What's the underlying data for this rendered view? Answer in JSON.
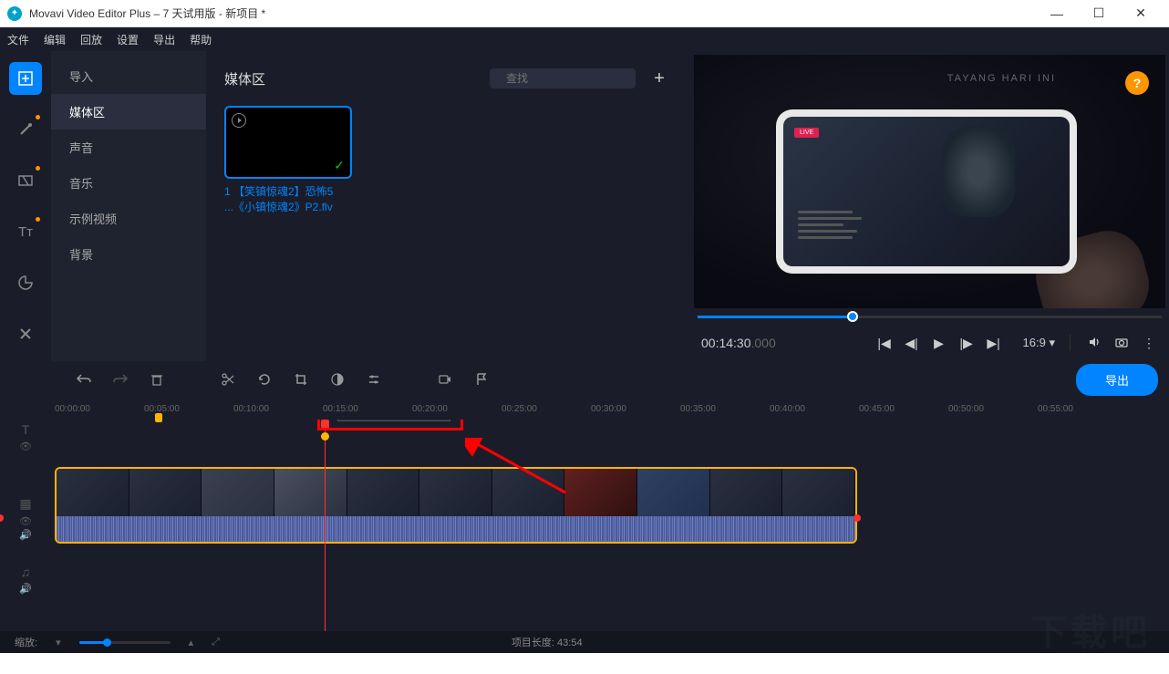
{
  "titlebar": {
    "title": "Movavi Video Editor Plus – 7 天试用版 - 新项目 *"
  },
  "menubar": {
    "items": [
      "文件",
      "编辑",
      "回放",
      "设置",
      "导出",
      "帮助"
    ]
  },
  "sidebar": {
    "items": [
      "导入",
      "媒体区",
      "声音",
      "音乐",
      "示例视频",
      "背景"
    ],
    "active_index": 1
  },
  "media_panel": {
    "title": "媒体区",
    "search_placeholder": "查找",
    "clip": {
      "line1": "1 【笑镇惊魂2】恐怖5",
      "line2": "...《小镇惊魂2》P2.flv"
    }
  },
  "preview": {
    "banner_text": "TAYANG HARI INI",
    "live_text": "LIVE",
    "time_main": "00:14:30",
    "time_ms": ".000",
    "ratio": "16:9",
    "help": "?"
  },
  "timeline": {
    "export_label": "导出",
    "ticks": [
      "00:00:00",
      "00:05:00",
      "00:10:00",
      "00:15:00",
      "00:20:00",
      "00:25:00",
      "00:30:00",
      "00:35:00",
      "00:40:00",
      "00:45:00",
      "00:50:00",
      "00:55:00"
    ],
    "text_input": "下载吧"
  },
  "status": {
    "zoom_label": "缩放:",
    "project_length": "项目长度:  43:54"
  },
  "watermark": "下载吧"
}
